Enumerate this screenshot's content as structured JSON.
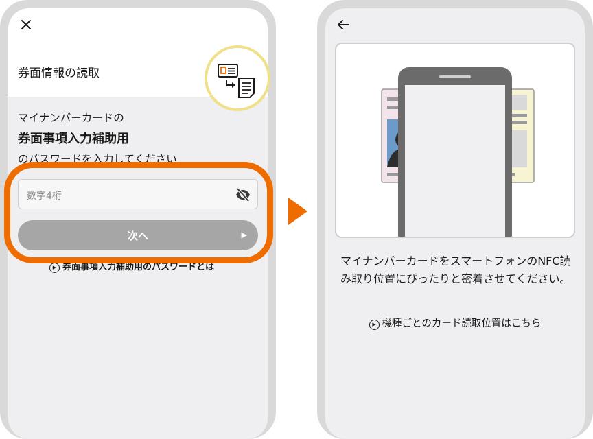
{
  "left_screen": {
    "header_title": "券面情報の読取",
    "prompt_line1": "マイナンバーカードの",
    "prompt_line2": "券面事項入力補助用",
    "prompt_line3": "のパスワードを入力してください",
    "password_input": {
      "placeholder": "数字4桁",
      "value": ""
    },
    "next_button_label": "次へ",
    "next_arrow": "▶",
    "help_link": "券面事項入力補助用のパスワードとは",
    "play_glyph": "▶"
  },
  "right_screen": {
    "instruction": "マイナンバーカードをスマートフォンのNFC読み取り位置にぴったりと密着させてください。",
    "card_position_link": "機種ごとのカード読取位置はこちら",
    "play_glyph": "▶"
  },
  "colors": {
    "accent_orange": "#ef6c00",
    "badge_ring": "#f0e08a",
    "button_gray": "#a6a6a6",
    "phone_frame": "#d9d9d9",
    "screen_bg": "#efeff1",
    "card_blue": "#6d9bc9",
    "card_pink": "#f3e3ea",
    "card_yellow": "#f6f4d2"
  },
  "icons": [
    "close-icon",
    "id-card-icon",
    "document-icon",
    "eye-slash-icon",
    "back-arrow-icon",
    "play-circle-icon"
  ]
}
